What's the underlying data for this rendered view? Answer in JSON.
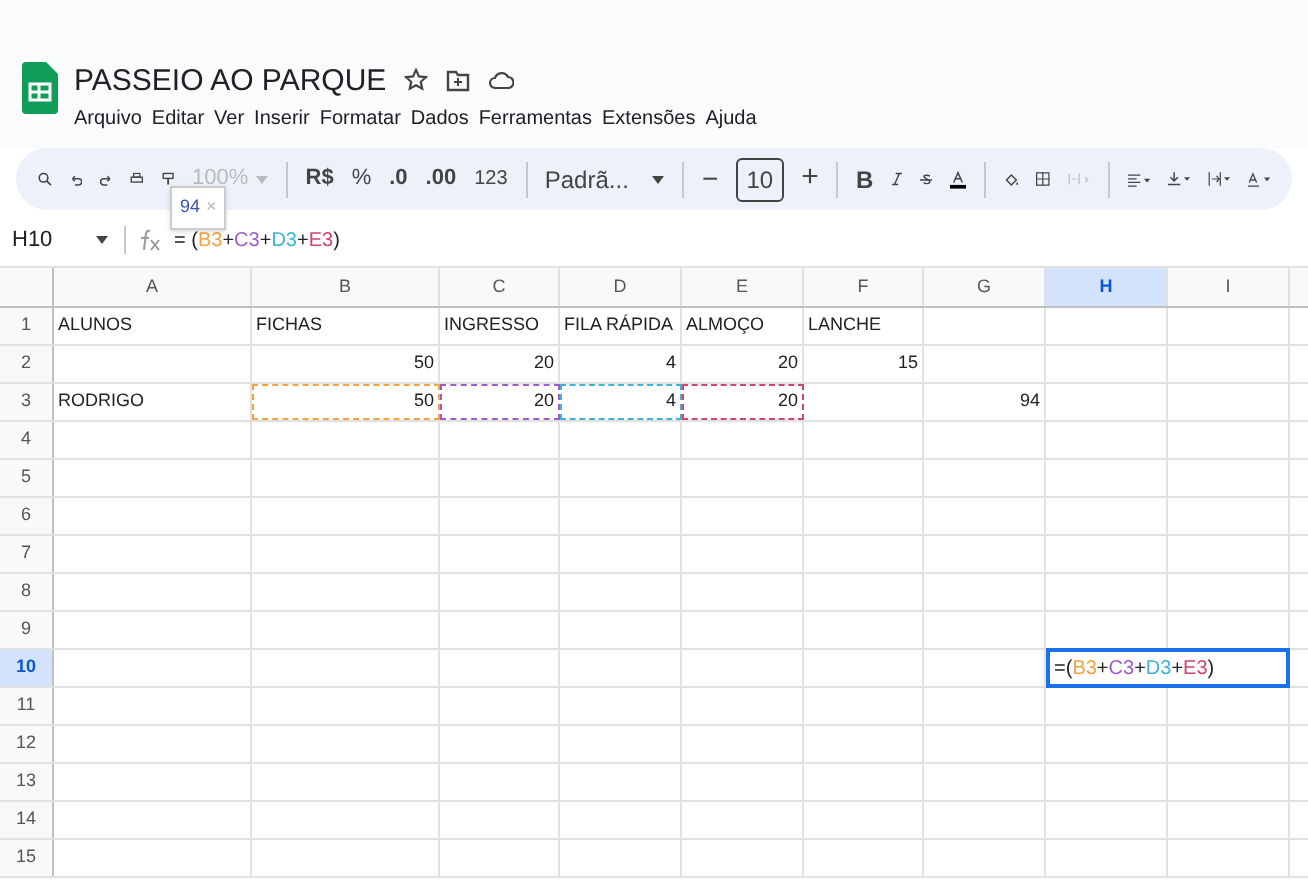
{
  "document": {
    "title": "PASSEIO AO PARQUE"
  },
  "menu": [
    "Arquivo",
    "Editar",
    "Ver",
    "Inserir",
    "Formatar",
    "Dados",
    "Ferramentas",
    "Extensões",
    "Ajuda"
  ],
  "toolbar": {
    "zoom": "100%",
    "currency": "R$",
    "percent": "%",
    "decrease_decimals": ".0",
    "increase_decimals": ".00",
    "number_format": "123",
    "font": "Padrã...",
    "font_size": "10",
    "minus": "−",
    "plus": "+",
    "bold": "B"
  },
  "tooltip": {
    "value": "94",
    "close": "×"
  },
  "formula_bar": {
    "cell": "H10",
    "tokens": [
      {
        "text": "= "
      },
      {
        "text": "("
      },
      {
        "text": "B3",
        "color": "#f4a340"
      },
      {
        "text": "+"
      },
      {
        "text": "C3",
        "color": "#a05bc8"
      },
      {
        "text": "+"
      },
      {
        "text": "D3",
        "color": "#3fb3d6"
      },
      {
        "text": "+"
      },
      {
        "text": "E3",
        "color": "#d1456e"
      },
      {
        "text": ")"
      }
    ]
  },
  "columns": [
    {
      "label": "A",
      "selected": false
    },
    {
      "label": "B",
      "selected": false
    },
    {
      "label": "C",
      "selected": false
    },
    {
      "label": "D",
      "selected": false
    },
    {
      "label": "E",
      "selected": false
    },
    {
      "label": "F",
      "selected": false
    },
    {
      "label": "G",
      "selected": false
    },
    {
      "label": "H",
      "selected": true
    },
    {
      "label": "I",
      "selected": false
    }
  ],
  "rows": [
    {
      "label": "1",
      "selected": false,
      "cells": [
        {
          "text": "ALUNOS",
          "kind": "text"
        },
        {
          "text": "FICHAS",
          "kind": "text"
        },
        {
          "text": "INGRESSO",
          "kind": "text"
        },
        {
          "text": "FILA RÁPIDA",
          "kind": "text"
        },
        {
          "text": "ALMOÇO",
          "kind": "text"
        },
        {
          "text": "LANCHE",
          "kind": "text"
        },
        null,
        null,
        null
      ]
    },
    {
      "label": "2",
      "selected": false,
      "cells": [
        null,
        {
          "text": "50",
          "kind": "number"
        },
        {
          "text": "20",
          "kind": "number"
        },
        {
          "text": "4",
          "kind": "number"
        },
        {
          "text": "20",
          "kind": "number"
        },
        {
          "text": "15",
          "kind": "number"
        },
        null,
        null,
        null
      ]
    },
    {
      "label": "3",
      "selected": false,
      "cells": [
        {
          "text": "RODRIGO",
          "kind": "text"
        },
        {
          "text": "50",
          "kind": "number",
          "color": "#f4a340"
        },
        {
          "text": "20",
          "kind": "number",
          "color": "#a05bc8"
        },
        {
          "text": "4",
          "kind": "number",
          "color": "#3fb3d6"
        },
        {
          "text": "20",
          "kind": "number",
          "color": "#d1456e"
        },
        null,
        {
          "text": "94",
          "kind": "number"
        },
        null,
        null
      ]
    },
    {
      "label": "4",
      "selected": false,
      "cells": []
    },
    {
      "label": "5",
      "selected": false,
      "cells": []
    },
    {
      "label": "6",
      "selected": false,
      "cells": []
    },
    {
      "label": "7",
      "selected": false,
      "cells": []
    },
    {
      "label": "8",
      "selected": false,
      "cells": []
    },
    {
      "label": "9",
      "selected": false,
      "cells": []
    },
    {
      "label": "10",
      "selected": true,
      "cells": [
        null,
        null,
        null,
        null,
        null,
        null,
        null,
        {
          "kind": "editor",
          "tokens": [
            {
              "text": "= "
            },
            {
              "text": "("
            },
            {
              "text": "B3",
              "color": "#f4a340"
            },
            {
              "text": "+"
            },
            {
              "text": "C3",
              "color": "#a05bc8"
            },
            {
              "text": "+"
            },
            {
              "text": "D3",
              "color": "#3fb3d6"
            },
            {
              "text": "+"
            },
            {
              "text": "E3",
              "color": "#d1456e"
            },
            {
              "text": ")"
            }
          ]
        },
        null
      ]
    },
    {
      "label": "11",
      "selected": false,
      "cells": []
    },
    {
      "label": "12",
      "selected": false,
      "cells": []
    },
    {
      "label": "13",
      "selected": false,
      "cells": []
    },
    {
      "label": "14",
      "selected": false,
      "cells": []
    },
    {
      "label": "15",
      "selected": false,
      "cells": []
    }
  ]
}
